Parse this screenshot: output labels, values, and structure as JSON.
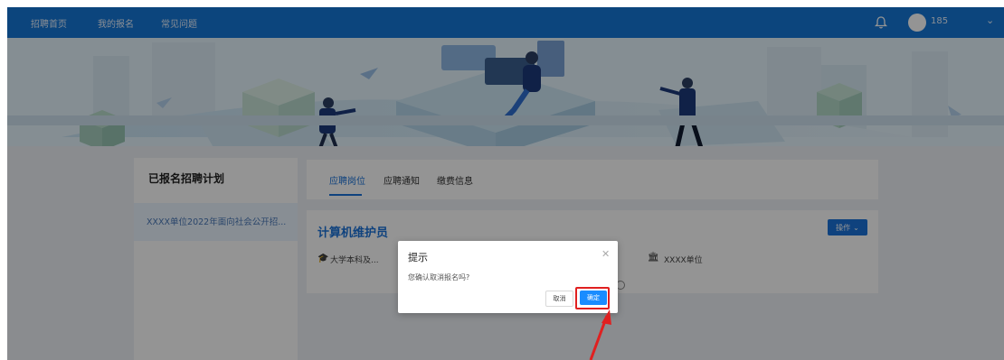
{
  "nav": {
    "links": [
      "招聘首页",
      "我的报名",
      "常见问题"
    ],
    "user_label": "185"
  },
  "sidebar": {
    "title": "已报名招聘计划",
    "items": [
      "XXXX单位2022年面向社会公开招..."
    ]
  },
  "tabs": [
    "应聘岗位",
    "应聘通知",
    "缴费信息"
  ],
  "job": {
    "title": "计算机维护员",
    "operate_label": "操作",
    "education": "大学本科及...",
    "unit": "XXXX单位"
  },
  "dialog": {
    "title": "提示",
    "message": "您确认取消报名吗?",
    "cancel_label": "取消",
    "confirm_label": "确定"
  },
  "colors": {
    "nav_bg": "#1677d8",
    "primary": "#1a73d9",
    "highlight": "#e02020"
  },
  "icons": [
    "bell-icon",
    "avatar",
    "chevron-down-icon",
    "graduation-cap-icon",
    "bank-icon",
    "close-icon",
    "clock-icon"
  ]
}
